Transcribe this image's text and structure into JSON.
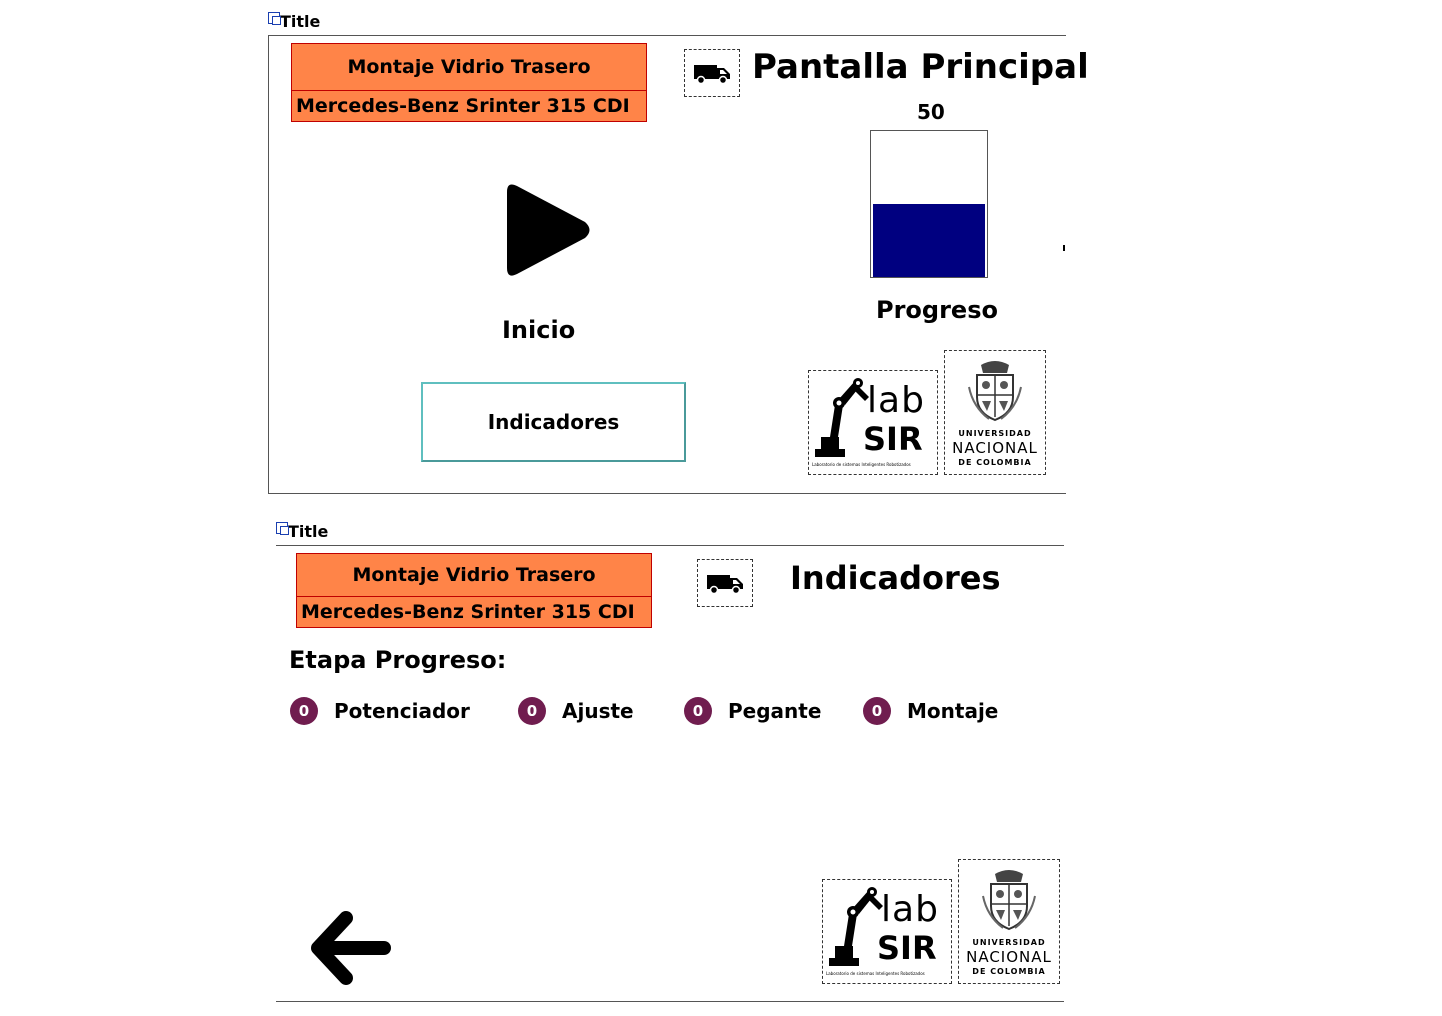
{
  "screen1": {
    "window_title": "Title",
    "header": {
      "line1": "Montaje Vidrio Trasero",
      "line2": "Mercedes-Benz Srinter 315 CDI"
    },
    "van_icon": "van-icon",
    "title": "Pantalla Principal",
    "progress_value": "50",
    "progress_fraction": 0.5,
    "progress_label": "Progreso",
    "play_icon": "play-icon",
    "start_label": "Inicio",
    "indicadores_button": "Indicadores",
    "logos": {
      "labsir": {
        "top": "lab",
        "bottom": "SIR",
        "caption": "Laboratorio de sistemas Inteligentes Robotizados"
      },
      "unal": {
        "line1": "UNIVERSIDAD",
        "line2": "NACIONAL",
        "line3": "DE COLOMBIA"
      }
    }
  },
  "screen2": {
    "window_title": "Title",
    "header": {
      "line1": "Montaje Vidrio Trasero",
      "line2": "Mercedes-Benz Srinter 315 CDI"
    },
    "van_icon": "van-icon",
    "title": "Indicadores",
    "section_label": "Etapa Progreso:",
    "stages": [
      {
        "value": "0",
        "label": "Potenciador"
      },
      {
        "value": "0",
        "label": "Ajuste"
      },
      {
        "value": "0",
        "label": "Pegante"
      },
      {
        "value": "0",
        "label": "Montaje"
      }
    ],
    "back_icon": "arrow-left-icon",
    "logos": {
      "labsir": {
        "top": "lab",
        "bottom": "SIR",
        "caption": "Laboratorio de sistemas Inteligentes Robotizados"
      },
      "unal": {
        "line1": "UNIVERSIDAD",
        "line2": "NACIONAL",
        "line3": "DE COLOMBIA"
      }
    }
  },
  "colors": {
    "header_bg": "#ff8448",
    "header_border": "#c00000",
    "progress_fill": "#000080",
    "badge": "#701d4f",
    "button_border": "#5fbfbf"
  }
}
